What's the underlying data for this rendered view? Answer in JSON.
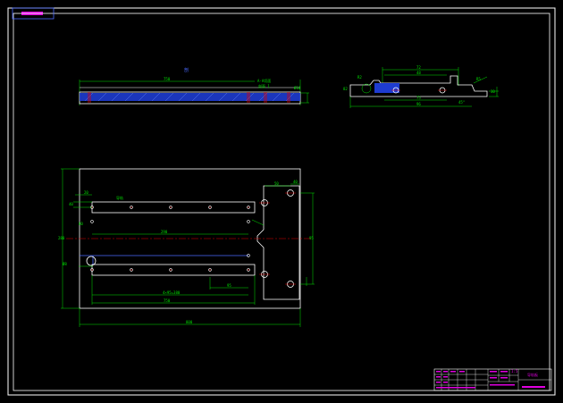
{
  "title_tab": {
    "label": ""
  },
  "colors": {
    "background": "#000000",
    "outline": "#ffffff",
    "dimension": "#00e000",
    "hatch": "#3a5aff",
    "centerline": "#e00000",
    "highlight": "#e000e0",
    "edge": "#4a6aff"
  },
  "drawing": {
    "section_mark": "剖",
    "top_view": {
      "length_label": "750",
      "note_1": "A-A切面",
      "note_2": "剖面 1",
      "thickness_label": "Ø10"
    },
    "side_view": {
      "top_width": "72",
      "inner_width": "48",
      "mid_width": "75",
      "bottom_width": "96",
      "left_radius": "R2",
      "left_height": "82",
      "right_height": "30",
      "angle_left": "45°",
      "angle_right": "R5"
    },
    "plan_view": {
      "hole_dia": "Ø8",
      "rail_label": "导轨",
      "center_length": "290",
      "span_length": "750",
      "offset_1": "20",
      "offset_2": "40",
      "pitch": "95",
      "overall_label": "4×95=380",
      "bottom_length": "750",
      "total_length": "800",
      "height_label": "95",
      "right_dim_1": "50",
      "right_dim_2": "40",
      "side_dim": "80",
      "left_height": "280"
    }
  },
  "title_block": {
    "drawing_name": "导轨板",
    "sheet_label": "",
    "scale": "1:5"
  }
}
